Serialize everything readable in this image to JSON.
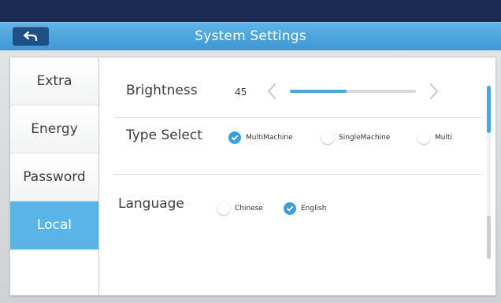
{
  "header": {
    "title": "System Settings",
    "back_icon": "back-arrow-icon"
  },
  "sidebar": {
    "items": [
      {
        "label": "Extra",
        "active": false
      },
      {
        "label": "Energy",
        "active": false
      },
      {
        "label": "Password",
        "active": false
      },
      {
        "label": "Local",
        "active": true
      }
    ]
  },
  "settings": {
    "brightness": {
      "label": "Brightness",
      "value": "45",
      "level_percent": 45
    },
    "type_select": {
      "label": "Type Select",
      "options": [
        {
          "label": "MultiMachine",
          "selected": true
        },
        {
          "label": "SingleMachine",
          "selected": false
        },
        {
          "label": "Multi",
          "selected": false
        }
      ]
    },
    "language": {
      "label": "Language",
      "options": [
        {
          "label": "Chinese",
          "selected": false
        },
        {
          "label": "English",
          "selected": true
        }
      ]
    }
  },
  "colors": {
    "accent": "#3f9fdc",
    "titlebar": "#4aa7de",
    "active_tab": "#5ab4e8",
    "back_button": "#1f4f86"
  }
}
